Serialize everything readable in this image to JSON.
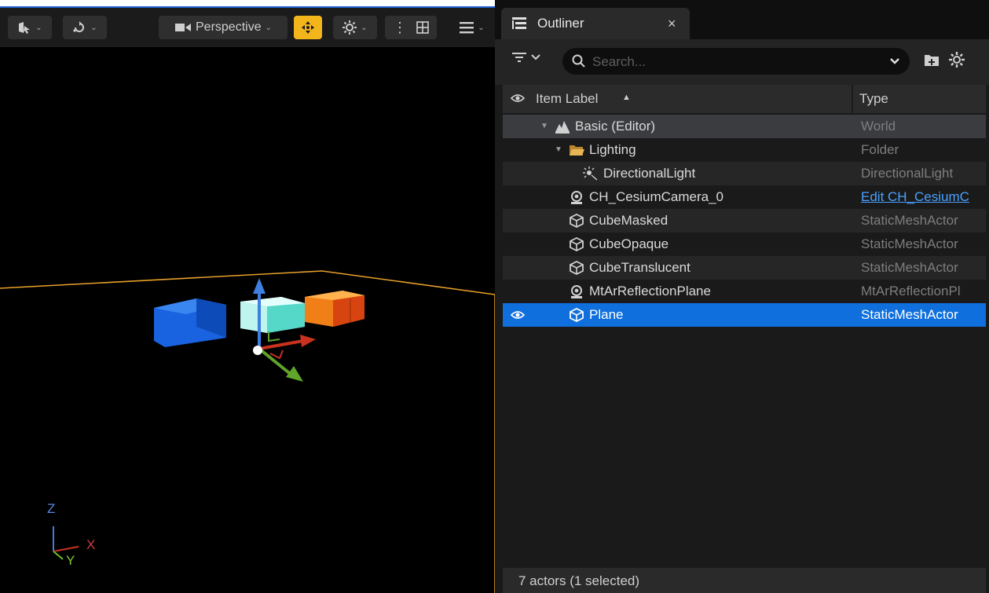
{
  "viewport": {
    "toolbar": {
      "camera_mode_label": "Perspective"
    },
    "axis_labels": {
      "z": "Z",
      "x": "X",
      "y": "Y"
    }
  },
  "outliner": {
    "tab_title": "Outliner",
    "tab_close": "×",
    "search_placeholder": "Search...",
    "header": {
      "item_label": "Item Label",
      "sort_indicator": "▲",
      "type": "Type"
    },
    "rows": [
      {
        "label": "Basic (Editor)",
        "type": "World",
        "icon": "world-icon"
      },
      {
        "label": "Lighting",
        "type": "Folder",
        "icon": "folder-icon"
      },
      {
        "label": "DirectionalLight",
        "type": "DirectionalLight",
        "icon": "directional-light-icon"
      },
      {
        "label": "CH_CesiumCamera_0",
        "type": "Edit CH_CesiumC",
        "icon": "actor-icon"
      },
      {
        "label": "CubeMasked",
        "type": "StaticMeshActor",
        "icon": "static-mesh-icon"
      },
      {
        "label": "CubeOpaque",
        "type": "StaticMeshActor",
        "icon": "static-mesh-icon"
      },
      {
        "label": "CubeTranslucent",
        "type": "StaticMeshActor",
        "icon": "static-mesh-icon"
      },
      {
        "label": "MtArReflectionPlane",
        "type": "MtArReflectionPl",
        "icon": "actor-icon"
      },
      {
        "label": "Plane",
        "type": "StaticMeshActor",
        "icon": "static-mesh-icon"
      }
    ],
    "status": "7 actors (1 selected)"
  },
  "colors": {
    "accent": "#0f6fdc",
    "highlight_button": "#f2b51c",
    "link": "#4aa1ff",
    "folder": "#d9a94a"
  }
}
